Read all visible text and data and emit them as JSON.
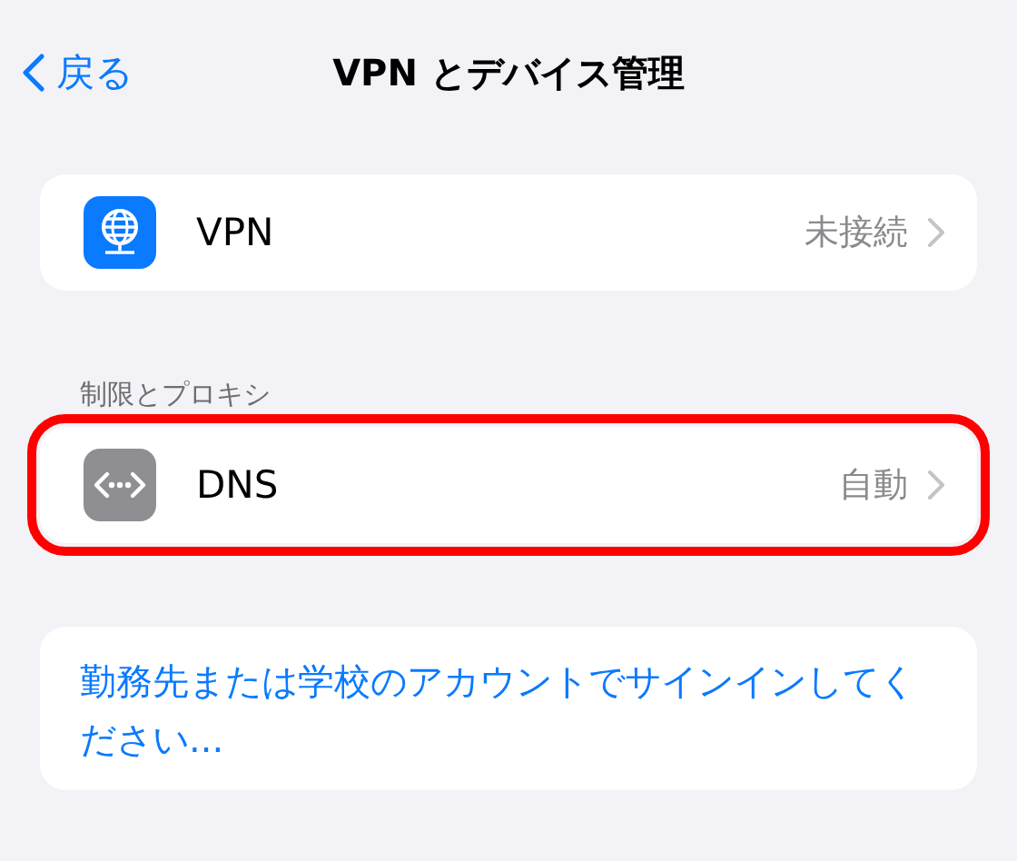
{
  "nav": {
    "back": "戻る",
    "title": "VPN とデバイス管理"
  },
  "sections": [
    {
      "rows": [
        {
          "kind": "vpn",
          "label": "VPN",
          "value": "未接続",
          "highlighted": false
        }
      ]
    },
    {
      "header": "制限とプロキシ",
      "rows": [
        {
          "kind": "dns",
          "label": "DNS",
          "value": "自動",
          "highlighted": true
        }
      ]
    }
  ],
  "link": "勤務先または学校のアカウントでサインインしてください..."
}
